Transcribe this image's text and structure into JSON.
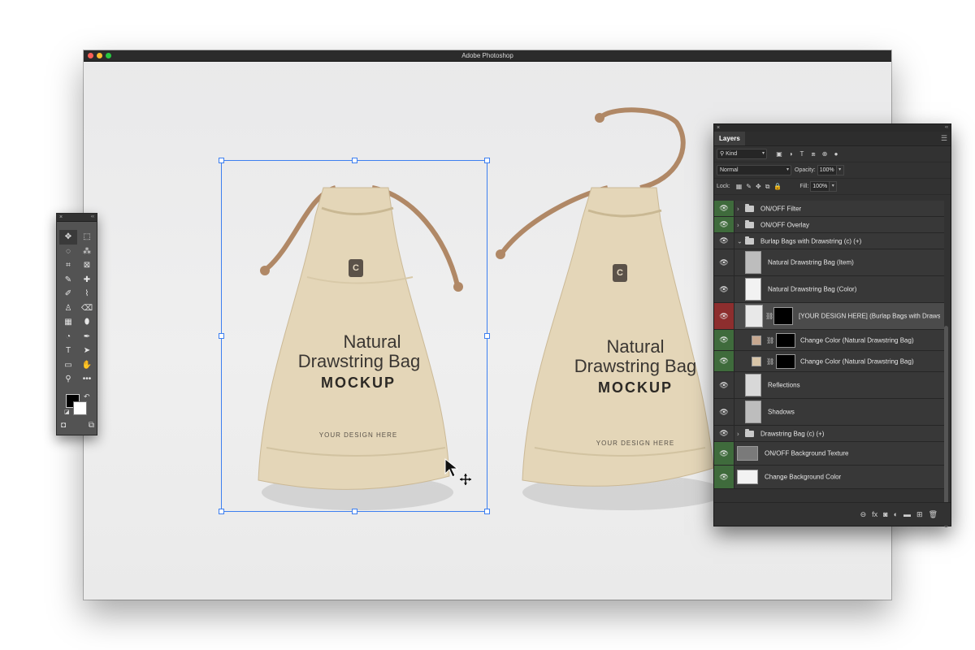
{
  "window": {
    "title": "Adobe Photoshop"
  },
  "mockup": {
    "logo_letter": "C",
    "line1": "Natural",
    "line2": "Drawstring Bag",
    "line3": "MOCKUP",
    "placeholder": "YOUR DESIGN HERE"
  },
  "tools_panel": {
    "close": "×",
    "collapse": "‹‹",
    "tools": [
      "✥",
      "⬚",
      "◌",
      "⁂",
      "⌗",
      "⊠",
      "✎",
      "✚",
      "✐",
      "⌇",
      "♙",
      "⌫",
      "▦",
      "⬮",
      "◔",
      "✒",
      "T",
      "➤",
      "▭",
      "✋",
      "⚲",
      "•••"
    ],
    "swap_colors": "↶",
    "default_colors": "◪",
    "quick_mask": "◘",
    "screen_mode": "⧉"
  },
  "layers_panel": {
    "close": "×",
    "collapse": "‹‹",
    "tab": "Layers",
    "menu": "☰",
    "filter_kind": "Kind",
    "filter_search_icon": "⚲",
    "filter_icons": [
      "▣",
      "◑",
      "T",
      "⧈",
      "⊕",
      "●"
    ],
    "blend_mode": "Normal",
    "opacity_label": "Opacity:",
    "opacity_value": "100%",
    "lock_label": "Lock:",
    "lock_icons": [
      "▦",
      "✎",
      "✥",
      "⧉",
      "🔒"
    ],
    "fill_label": "Fill:",
    "fill_value": "100%",
    "layers": [
      {
        "name": "ON/OFF Filter",
        "eye": "green"
      },
      {
        "name": "ON/OFF Overlay",
        "eye": "green"
      },
      {
        "name": "Burlap Bags with Drawstring (c) (+)",
        "eye": "none"
      },
      {
        "name": "Natural Drawstring Bag (Item)",
        "eye": "none"
      },
      {
        "name": "Natural Drawstring Bag (Color)",
        "eye": "none"
      },
      {
        "name": "[YOUR DESIGN HERE] (Burlap Bags with Drawstring)",
        "eye": "red"
      },
      {
        "name": "Change Color (Natural Drawstring Bag)",
        "eye": "green"
      },
      {
        "name": "Change Color (Natural Drawstring Bag)",
        "eye": "green"
      },
      {
        "name": "Reflections",
        "eye": "none"
      },
      {
        "name": "Shadows",
        "eye": "none"
      },
      {
        "name": "Drawstring Bag (c) (+)",
        "eye": "none"
      },
      {
        "name": "ON/OFF Background Texture",
        "eye": "green"
      },
      {
        "name": "Change Background Color",
        "eye": "green"
      }
    ],
    "eye_glyph": "👁",
    "footer_icons": [
      "⊖",
      "fx",
      "◙",
      "◐",
      "▬",
      "⊞",
      "🗑"
    ],
    "colors": {
      "bag_fill": "#e4d6b8",
      "swatch_color": "#c7a890",
      "swatch_color_2": "#d8c5a8"
    }
  }
}
